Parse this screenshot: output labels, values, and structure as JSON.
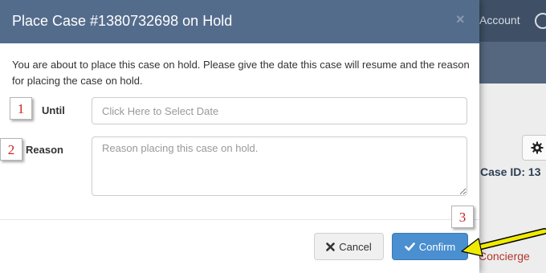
{
  "background": {
    "account_label": "Account",
    "case_id_label": "Case ID: 13",
    "concierge_label": "Concierge"
  },
  "modal": {
    "title": "Place Case #1380732698 on Hold",
    "close_symbol": "×",
    "intro_text": "You are about to place this case on hold. Please give the date this case will resume and the reason for placing the case on hold.",
    "until_label": "Until",
    "until_placeholder": "Click Here to Select Date",
    "reason_label": "Reason",
    "reason_placeholder": "Reason placing this case on hold.",
    "cancel_label": "Cancel",
    "confirm_label": "Confirm"
  },
  "callouts": [
    "1",
    "2",
    "3"
  ],
  "icons": {
    "cancel": "times-icon",
    "confirm": "check-icon",
    "settings": "gear-icon",
    "globe": "globe-icon"
  },
  "colors": {
    "header": "#546c8c",
    "topbar": "#3f5066",
    "confirm": "#4a8fcf",
    "callout_text": "#cc2222",
    "arrow": "#f0ea00",
    "link_red": "#b3362c"
  }
}
